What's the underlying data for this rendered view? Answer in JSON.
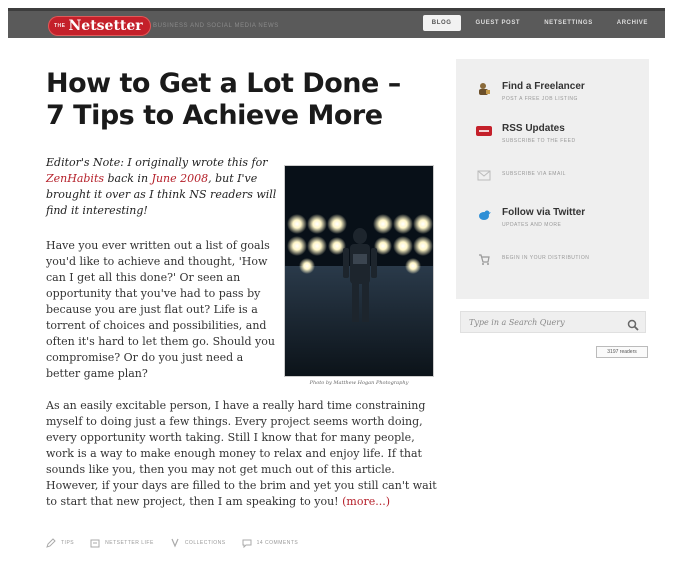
{
  "header": {
    "logo_prefix": "THE",
    "logo_name": "Netsetter",
    "tagline": "BUSINESS AND SOCIAL MEDIA NEWS",
    "nav": [
      {
        "label": "BLOG",
        "active": true
      },
      {
        "label": "GUEST POST",
        "active": false
      },
      {
        "label": "NETSETTINGS",
        "active": false
      },
      {
        "label": "ARCHIVE",
        "active": false
      }
    ]
  },
  "article": {
    "title": "How to Get a Lot Done – 7 Tips to Achieve More",
    "editor_note": {
      "part1": "Editor's Note: I originally wrote this for ",
      "link1": "ZenHabits",
      "part2": " back in ",
      "link2": "June 2008",
      "part3": ", but I've brought it over as I think NS readers will find it interesting!"
    },
    "paragraph1": "Have you ever written out a list of goals you'd like to achieve and thought, 'How can I get all this done?' Or seen an opportunity that you've had to pass by because you are just flat out? Life is a torrent of choices and possibilities, and often it's hard to let them go. Should you compromise? Or do you just need a better game plan?",
    "paragraph2": "As an easily excitable person, I have a really hard time constraining myself to doing just a few things. Every project seems worth doing, every opportunity worth taking. Still I know that for many people, work is a way to make enough money to relax and enjoy life. If that sounds like you, then you may not get much out of this article. However, if your days are filled to the brim and yet you still can't wait to start that new project, then I am speaking to you! ",
    "more_link": "(more...)",
    "photo_caption": "Photo by Matthew Hogan Photography",
    "meta": [
      {
        "icon": "pencil-icon",
        "label": "TIPS"
      },
      {
        "icon": "folder-icon",
        "label": "NETSETTER LIFE"
      },
      {
        "icon": "tag-icon",
        "label": "COLLECTIONS"
      },
      {
        "icon": "comment-icon",
        "label": "14 COMMENTS"
      }
    ]
  },
  "sidebar": {
    "items": [
      {
        "icon": "freelancer-icon",
        "title": "Find a Freelancer",
        "sub": "POST A FREE JOB LISTING"
      },
      {
        "icon": "rss-icon",
        "title": "RSS Updates",
        "sub": "SUBSCRIBE TO THE FEED"
      },
      {
        "icon": "email-icon",
        "title": "",
        "sub": "SUBSCRIBE VIA EMAIL"
      },
      {
        "icon": "twitter-bird-icon",
        "title": "Follow via Twitter",
        "sub": "UPDATES AND MORE"
      },
      {
        "icon": "cart-icon",
        "title": "",
        "sub": "BEGIN IN YOUR DISTRIBUTION"
      }
    ],
    "search_placeholder": "Type in a Search Query",
    "readers_badge": "3197 readers"
  },
  "colors": {
    "accent": "#b5202a",
    "topbar": "#5a5a5a",
    "sidebar_bg": "#efefef"
  }
}
